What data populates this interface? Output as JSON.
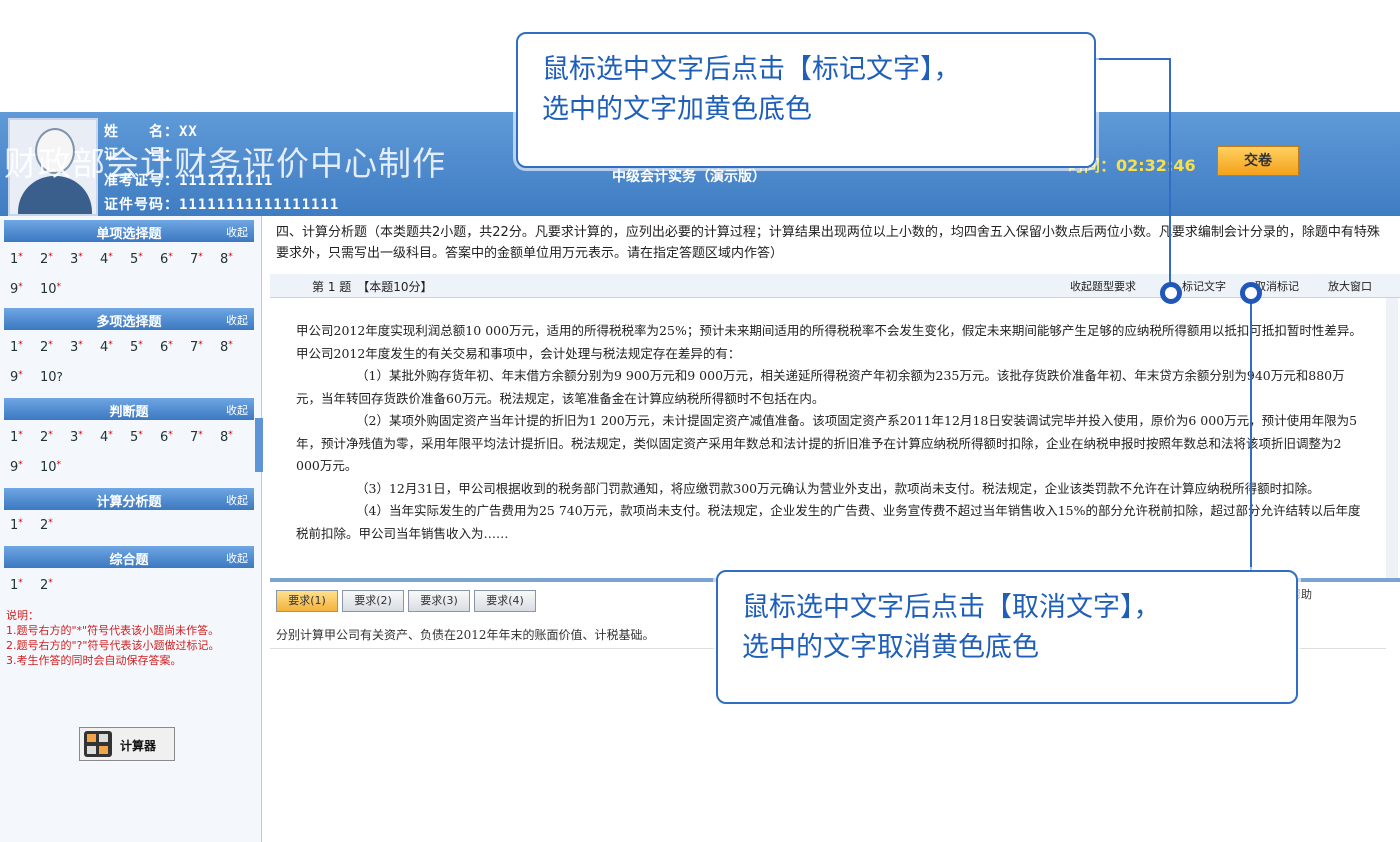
{
  "header": {
    "name_row": "姓　　名：XX",
    "id_row": "证　　号：",
    "ticket_row": "准考证号：1111111111",
    "cert_row": "证件号码：11111111111111111",
    "watermark": "财政部会计财务评价中心制作",
    "exam_title": "中级会计实务（演示版）",
    "timer": "时间：02:32:46",
    "submit_label": "交卷"
  },
  "sidebar": {
    "collapse_label": "收起",
    "sections": [
      {
        "title": "单项选择题",
        "rows": [
          [
            "1",
            "2",
            "3",
            "4",
            "5",
            "6",
            "7",
            "8"
          ],
          [
            "9",
            "10"
          ]
        ]
      },
      {
        "title": "多项选择题",
        "rows": [
          [
            "1",
            "2",
            "3",
            "4",
            "5",
            "6",
            "7",
            "8"
          ],
          [
            "9",
            "10"
          ]
        ]
      },
      {
        "title": "判断题",
        "rows": [
          [
            "1",
            "2",
            "3",
            "4",
            "5",
            "6",
            "7",
            "8"
          ],
          [
            "9",
            "10"
          ]
        ]
      },
      {
        "title": "计算分析题",
        "rows": [
          [
            "1",
            "2"
          ]
        ]
      },
      {
        "title": "综合题",
        "rows": [
          [
            "1",
            "2"
          ]
        ]
      }
    ],
    "notes": [
      "说明：",
      "1.题号右方的\"*\"符号代表该小题尚未作答。",
      "2.题号右方的\"?\"符号代表该小题做过标记。",
      "3.考生作答的同时会自动保存答案。"
    ],
    "calculator_label": "计算器"
  },
  "main": {
    "instructions": "四、计算分析题（本类题共2小题，共22分。凡要求计算的，应列出必要的计算过程；计算结果出现两位以上小数的，均四舍五入保留小数点后两位小数。凡要求编制会计分录的，除题中有特殊要求外，只需写出一级科目。答案中的金额单位用万元表示。请在指定答题区域内作答）",
    "question_num": "第 1 题　【本题10分】",
    "toolbar": {
      "collapse_req": "收起题型要求",
      "mark": "标记文字",
      "unmark": "取消标记",
      "enlarge": "放大窗口"
    },
    "paragraphs": [
      "甲公司2012年度实现利润总额10 000万元，适用的所得税税率为25%；预计未来期间适用的所得税税率不会发生变化，假定未来期间能够产生足够的应纳税所得额用以抵扣可抵扣暂时性差异。甲公司2012年度发生的有关交易和事项中，会计处理与税法规定存在差异的有：",
      "（1）某批外购存货年初、年末借方余额分别为9 900万元和9 000万元，相关递延所得税资产年初余额为235万元。该批存货跌价准备年初、年末贷方余额分别为940万元和880万元，当年转回存货跌价准备60万元。税法规定，该笔准备金在计算应纳税所得额时不包括在内。",
      "（2）某项外购固定资产当年计提的折旧为1 200万元，未计提固定资产减值准备。该项固定资产系2011年12月18日安装调试完毕并投入使用，原价为6 000万元，预计使用年限为5年，预计净残值为零，采用年限平均法计提折旧。税法规定，类似固定资产采用年数总和法计提的折旧准予在计算应纳税所得额时扣除，企业在纳税申报时按照年数总和法将该项折旧调整为2 000万元。",
      "（3）12月31日，甲公司根据收到的税务部门罚款通知，将应缴罚款300万元确认为营业外支出，款项尚未支付。税法规定，企业该类罚款不允许在计算应纳税所得额时扣除。",
      "（4）当年实际发生的广告费用为25 740万元，款项尚未支付。税法规定，企业发生的广告费、业务宣传费不超过当年销售收入15%的部分允许税前扣除，超过部分允许结转以后年度税前扣除。甲公司当年销售收入为……"
    ],
    "tabs": [
      "要求(1)",
      "要求(2)",
      "要求(3)",
      "要求(4)"
    ],
    "requirement_text": "分别计算甲公司有关资产、负债在2012年年末的账面价值、计税基础。",
    "right_tools": "帮助"
  },
  "callouts": {
    "top_line1": "鼠标选中文字后点击【标记文字】，",
    "top_line2": "选中的文字加黄色底色",
    "bottom_line1": "鼠标选中文字后点击【取消文字】，",
    "bottom_line2": "选中的文字取消黄色底色"
  },
  "colors": {
    "header_blue": "#4a87cc",
    "accent_callout": "#2f6ec4",
    "submit": "#f4a21a",
    "note_red": "#d02020"
  }
}
